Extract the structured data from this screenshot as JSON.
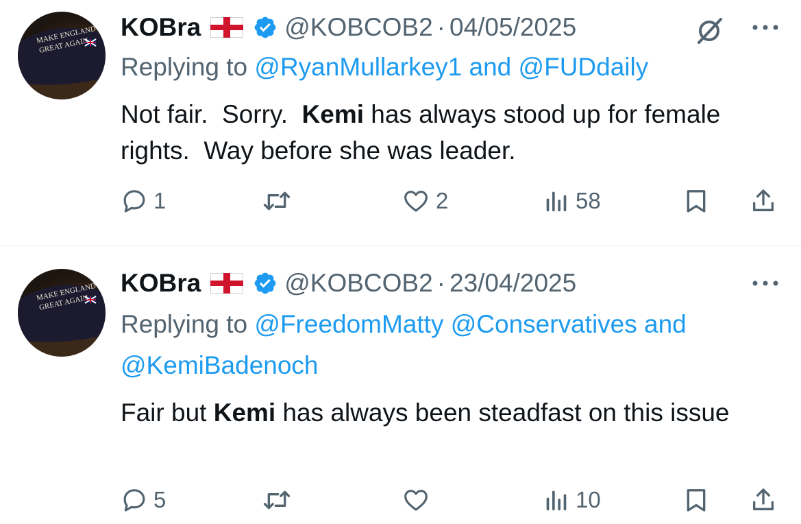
{
  "tweets": [
    {
      "name": "KOBra",
      "handle": "@KOBCOB2",
      "separator": "·",
      "date": "04/05/2025",
      "reply_prefix": "Replying to ",
      "reply_mentions": [
        "@RyanMullarkey1",
        "@FUDdaily"
      ],
      "reply_joiner": " and ",
      "body_before": "Not fair.  Sorry.  ",
      "body_bold": "Kemi",
      "body_after": " has always stood up for female rights.  Way before she was leader.",
      "replies": "1",
      "retweets": "",
      "likes": "2",
      "views": "58",
      "avatar_text": [
        "MAKE ENGLAND",
        "GREAT AGAIN"
      ]
    },
    {
      "name": "KOBra",
      "handle": "@KOBCOB2",
      "separator": "·",
      "date": "23/04/2025",
      "reply_prefix": "Replying to ",
      "reply_mentions": [
        "@FreedomMatty",
        "@Conservatives",
        "@KemiBadenoch"
      ],
      "reply_joiner": " and ",
      "body_before": "Fair but ",
      "body_bold": "Kemi",
      "body_after": " has always been steadfast on this issue",
      "replies": "5",
      "retweets": "",
      "likes": "",
      "views": "10",
      "avatar_text": [
        "MAKE ENGLAND",
        "GREAT AGAIN"
      ]
    }
  ],
  "icons": {
    "reply": "speech-bubble",
    "retweet": "two-arrows-loop",
    "like": "heart-outline",
    "views": "bar-chart",
    "bookmark": "bookmark-outline",
    "share": "upload-arrow",
    "grok": "slashed-circle",
    "more": "three-dots",
    "verified": "blue-check-badge",
    "flag": "england-st-george-cross"
  },
  "colors": {
    "text": "#0f1419",
    "muted": "#536471",
    "link": "#1d9bf0",
    "verified": "#1d9bf0",
    "flag_red": "#cf142b",
    "divider": "#eff3f4"
  }
}
